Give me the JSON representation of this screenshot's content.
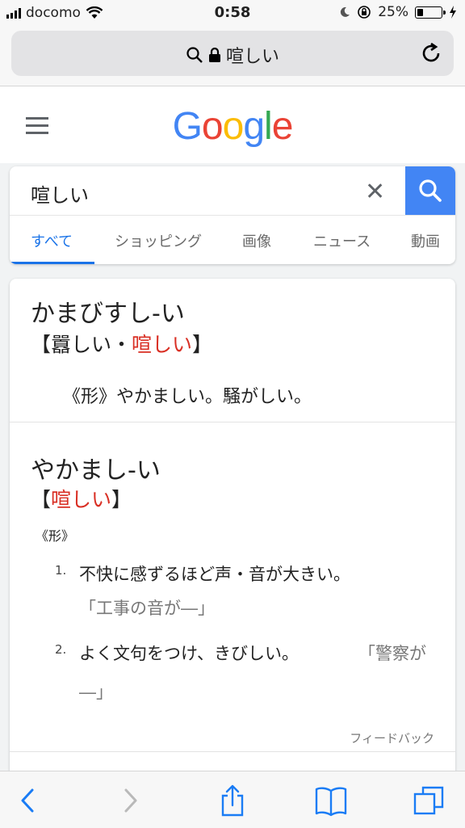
{
  "status": {
    "carrier": "docomo",
    "time": "0:58",
    "battery": "25%",
    "battery_level": 0.25
  },
  "browser": {
    "url_text": "喧しい",
    "icons": [
      "search-icon",
      "lock-icon",
      "reload-icon"
    ]
  },
  "google": {
    "logo_letters": [
      {
        "ch": "G",
        "color": "#4285F4"
      },
      {
        "ch": "o",
        "color": "#EA4335"
      },
      {
        "ch": "o",
        "color": "#FBBC05"
      },
      {
        "ch": "g",
        "color": "#4285F4"
      },
      {
        "ch": "l",
        "color": "#34A853"
      },
      {
        "ch": "e",
        "color": "#EA4335"
      }
    ]
  },
  "search": {
    "query": "喧しい",
    "clear": "✕",
    "tabs": [
      "すべて",
      "ショッピング",
      "画像",
      "ニュース",
      "動画"
    ],
    "active_tab": "すべて"
  },
  "result": {
    "entry1": {
      "title": "かまびすし-い",
      "kanji_open": "【",
      "kanji_main": "囂しい・",
      "kanji_red": "喧しい",
      "kanji_close": "】",
      "meaning": "《形》やかましい。騒がしい。"
    },
    "entry2": {
      "title": "やかまし-い",
      "kanji_open": "【",
      "kanji_red": "喧しい",
      "kanji_close": "】",
      "pos": "《形》",
      "defs": [
        {
          "num": "1.",
          "text": "不快に感ずるほど声・音が大きい。",
          "example": "「工事の音が―」"
        },
        {
          "num": "2.",
          "text": "よく文句をつけ、きびしい。",
          "example": "「警察が",
          "example2": "―」"
        }
      ]
    },
    "feedback": "フィードバック"
  },
  "toolbar": {
    "icons": [
      "back-icon",
      "forward-icon",
      "share-icon",
      "bookmarks-icon",
      "tabs-icon"
    ]
  }
}
